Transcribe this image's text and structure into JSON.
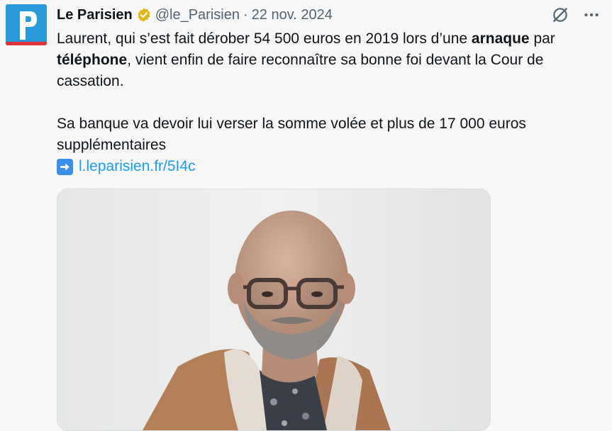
{
  "tweet": {
    "author": {
      "name": "Le Parisien",
      "handle": "@le_Parisien",
      "avatar_letter": "P",
      "brand_color": "#2a9bd8"
    },
    "separator": "·",
    "date": "22 nov. 2024",
    "text": {
      "p1_a": "Laurent, qui s’est fait dérober 54 500 euros en 2019 lors d’une ",
      "p1_bold1": "arnaque",
      "p1_b": " par ",
      "p1_bold2": "téléphone",
      "p1_c": ", vient enfin de faire reconnaître sa bonne foi devant la Cour de cassation.",
      "p2": "Sa banque va devoir lui verser la somme volée et plus de 17 000 euros supplémentaires",
      "link": "l.leparisien.fr/5I4c"
    },
    "icons": {
      "verified": "verified-badge-icon",
      "grok": "grok-icon",
      "more": "more-icon",
      "link_arrow": "right-arrow-icon"
    },
    "link_color": "#1d9bf0"
  }
}
